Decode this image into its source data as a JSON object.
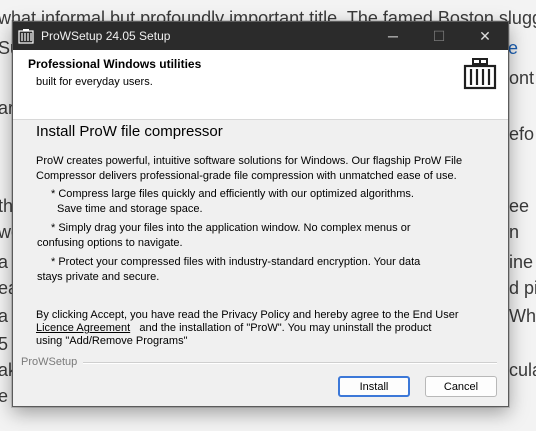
{
  "background": {
    "lines": [
      "what informal but profoundly important title. The famed Boston slugg",
      "Su",
      "ont",
      "arl",
      "efo",
      "th",
      "ee",
      "we",
      "n",
      "a",
      "ine",
      "ea",
      "d pi",
      "a",
      "Wh",
      "5",
      "ak",
      "cula",
      "e"
    ],
    "link_text": "e"
  },
  "window": {
    "title": "ProWSetup 24.05 Setup",
    "controls": {
      "minimize": "─",
      "maximize": "☐",
      "close": "✕"
    }
  },
  "header": {
    "title": "Professional Windows utilities",
    "subtitle": "built for everyday users."
  },
  "content": {
    "title": "Install ProW file compressor",
    "intro": "ProW creates powerful, intuitive software solutions for Windows. Our flagship ProW File Compressor delivers professional-grade file compression with unmatched ease of use.",
    "bullets": [
      {
        "line1": "* Compress large files quickly and efficiently with our optimized algorithms.",
        "line2": "Save time and storage space."
      },
      {
        "line1": "* Simply drag your files into the application window. No complex menus or",
        "line2": "confusing options to navigate."
      },
      {
        "line1": "* Protect your compressed files with industry-standard encryption. Your data",
        "line2": "stays private and secure."
      }
    ]
  },
  "license": {
    "part1": "By clicking Accept, you have read the Privacy Policy  and hereby agree to the End User",
    "link": "Licence Agreement",
    "part2": "   and the installation of \"ProW\". You may uninstall the product",
    "part3": "using \"Add/Remove Programs\""
  },
  "footer": {
    "group_label": "ProWSetup",
    "install_label": "Install",
    "cancel_label": "Cancel"
  },
  "colors": {
    "titlebar": "#2b2b2b",
    "accent": "#3c78d8",
    "link": "#1a5fb4"
  }
}
